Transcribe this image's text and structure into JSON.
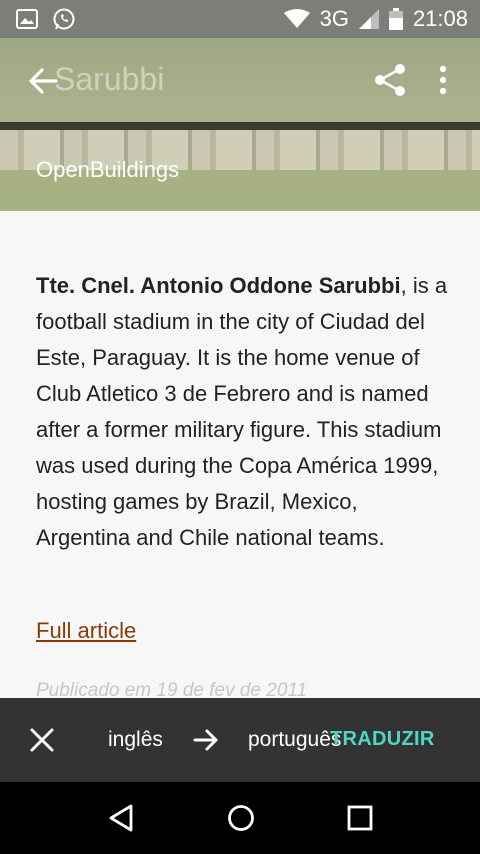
{
  "status_bar": {
    "network": "3G",
    "time": "21:08",
    "icons": [
      "image-icon",
      "whatsapp-icon",
      "wifi-icon",
      "cellular-signal-icon",
      "battery-icon"
    ]
  },
  "app_bar": {
    "title": "Sarubbi",
    "source": "OpenBuildings",
    "icons": [
      "back-arrow-icon",
      "share-icon",
      "more-vertical-icon"
    ]
  },
  "article": {
    "name": "Tte. Cnel. Antonio Oddone Sarubbi",
    "body": ", is a football stadium in the city of Ciudad del Este, Paraguay. It is the home venue of Club Atletico 3 de Febrero and is named after a former military figure. This stadium was used during the Copa América 1999, hosting games by Brazil, Mexico, Argentina and Chile national teams.",
    "full_article_label": "Full article",
    "published": "Publicado em 19 de fev de 2011"
  },
  "translate_bar": {
    "from_language": "inglês",
    "to_language": "português",
    "action_label": "TRADUZIR",
    "action_color": "#4fd6c6",
    "icons": [
      "close-icon",
      "arrow-right-icon"
    ]
  },
  "nav_bar": {
    "icons": [
      "nav-back-icon",
      "nav-home-icon",
      "nav-recent-apps-icon"
    ]
  }
}
